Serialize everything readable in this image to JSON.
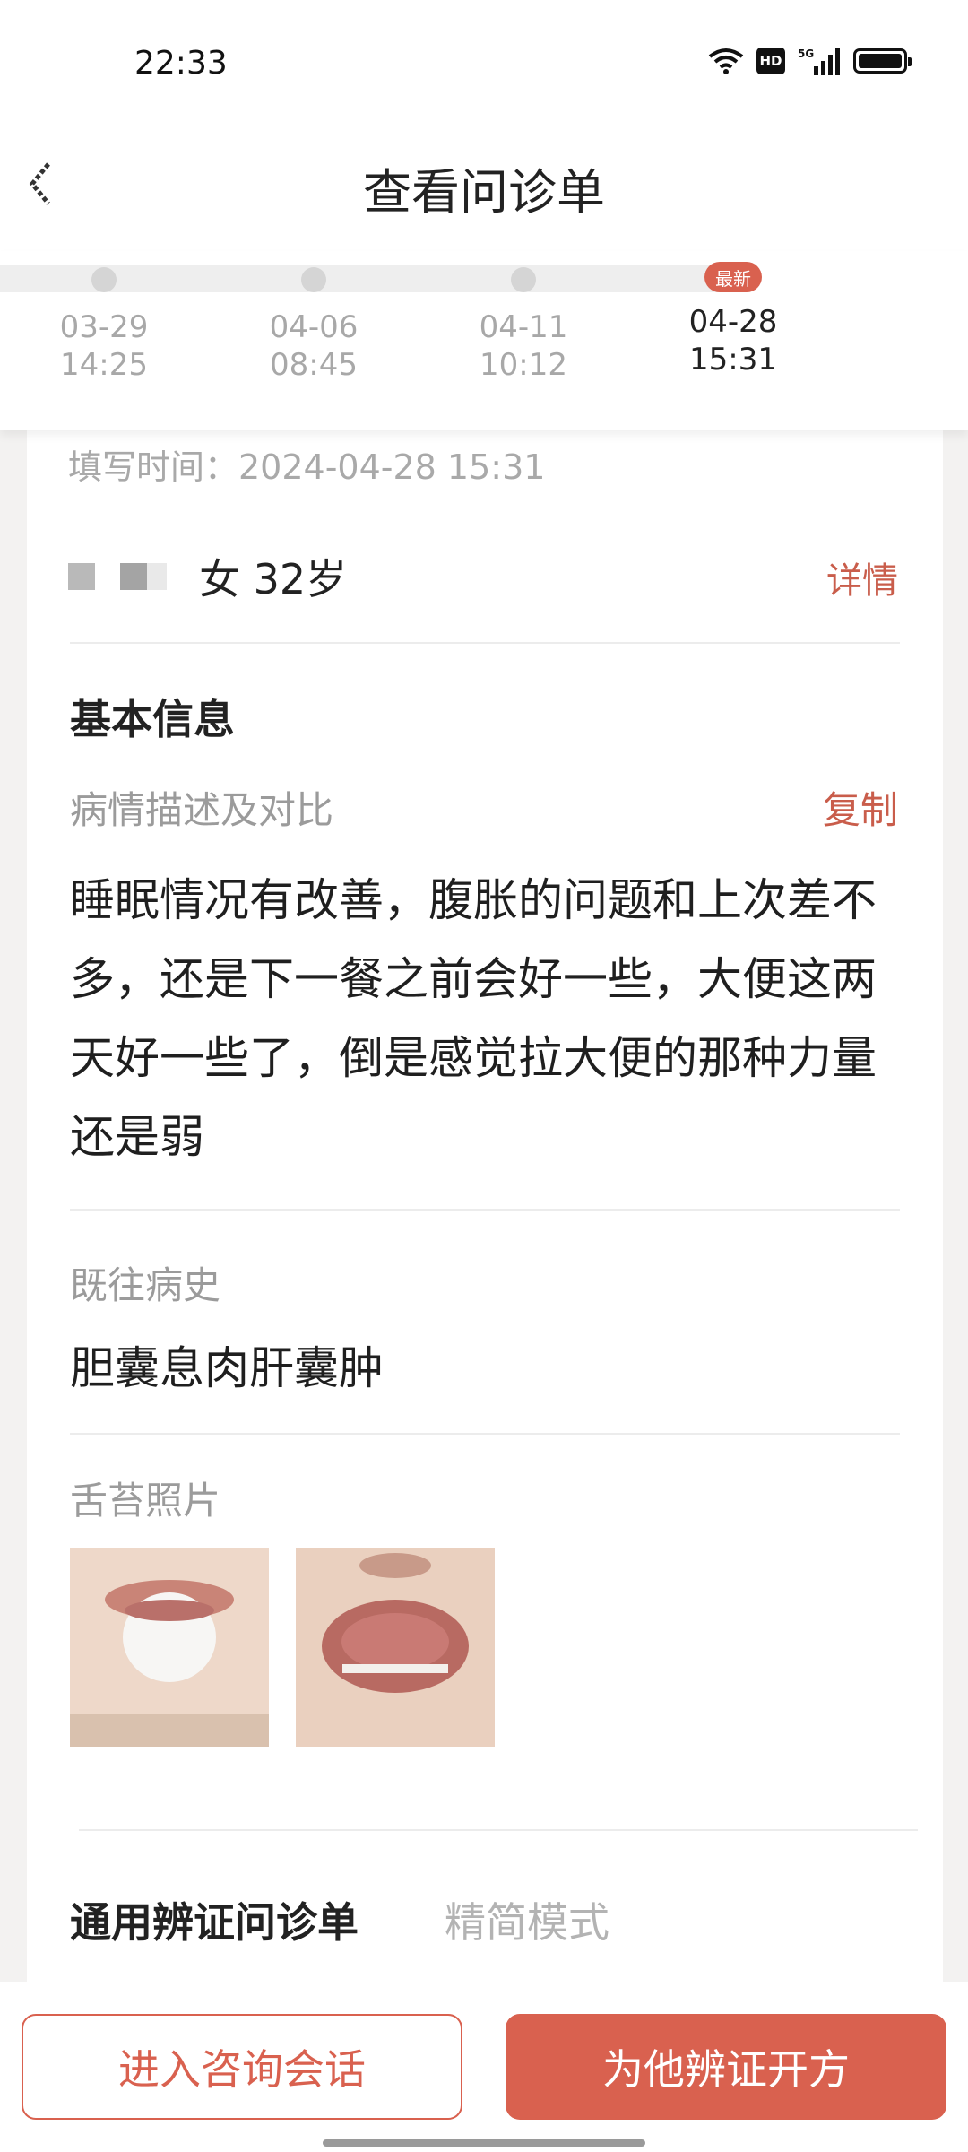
{
  "status_bar": {
    "time": "22:33",
    "hd_label": "HD",
    "network_label": "5G"
  },
  "header": {
    "title": "查看问诊单"
  },
  "timeline": {
    "badge": "最新",
    "entries": [
      {
        "date": "03-29",
        "time": "14:25"
      },
      {
        "date": "04-06",
        "time": "08:45"
      },
      {
        "date": "04-11",
        "time": "10:12"
      },
      {
        "date": "04-28",
        "time": "15:31"
      }
    ]
  },
  "record": {
    "fill_time": "填写时间：2024-04-28 15:31",
    "patient_info": "女 32岁",
    "detail_link": "详情"
  },
  "basic_info": {
    "section_title": "基本信息",
    "description_label": "病情描述及对比",
    "copy_link": "复制",
    "description": "睡眠情况有改善，腹胀的问题和上次差不多，还是下一餐之前会好一些，大便这两天好一些了，倒是感觉拉大便的那种力量还是弱",
    "history_label": "既往病史",
    "history": "胆囊息肉肝囊肿",
    "tongue_label": "舌苔照片"
  },
  "questionnaire": {
    "title": "通用辨证问诊单",
    "mode": "精简模式"
  },
  "actions": {
    "consult": "进入咨询会话",
    "prescribe": "为他辨证开方"
  },
  "colors": {
    "accent": "#d9614f",
    "link": "#c95d4b"
  }
}
